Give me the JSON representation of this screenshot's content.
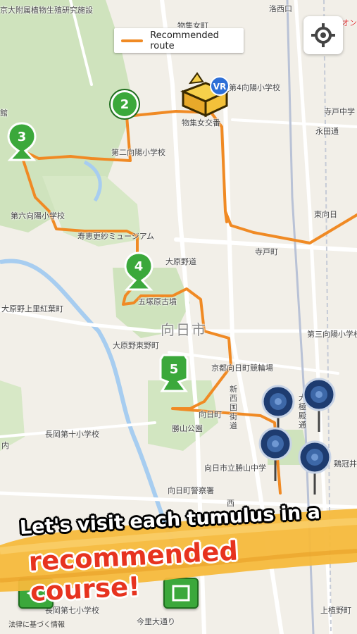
{
  "legend": {
    "label": "Recommended route"
  },
  "locate_button": {
    "icon": "crosshair-icon"
  },
  "map": {
    "labels": [
      {
        "id": "l1",
        "text": "京大附属植物生殖研究施設"
      },
      {
        "id": "l2",
        "text": "物集女町"
      },
      {
        "id": "l3",
        "text": "洛西口"
      },
      {
        "id": "l4",
        "text": "イオンモ"
      },
      {
        "id": "l5",
        "text": "第4向陽小学校"
      },
      {
        "id": "l6",
        "text": "寺戸中学"
      },
      {
        "id": "l7",
        "text": "永田通"
      },
      {
        "id": "l8",
        "text": "物集女交番"
      },
      {
        "id": "l9",
        "text": "第二向陽小学校"
      },
      {
        "id": "l10",
        "text": "東向日"
      },
      {
        "id": "l11",
        "text": "第六向陽小学校"
      },
      {
        "id": "l12",
        "text": "寿恵更紗ミュージアム"
      },
      {
        "id": "l13",
        "text": "寺戸町"
      },
      {
        "id": "l14",
        "text": "大原野道"
      },
      {
        "id": "l15",
        "text": "五塚原古墳"
      },
      {
        "id": "l16",
        "text": "大原野上里紅葉町"
      },
      {
        "id": "l17",
        "text": "向日市"
      },
      {
        "id": "l18",
        "text": "第三向陽小学校"
      },
      {
        "id": "l19",
        "text": "大原野東野町"
      },
      {
        "id": "l20",
        "text": "京都向日町競輪場"
      },
      {
        "id": "l21",
        "text": "新西国街道"
      },
      {
        "id": "l22",
        "text": "大極殿通"
      },
      {
        "id": "l23",
        "text": "向日町"
      },
      {
        "id": "l24",
        "text": "勝山公園"
      },
      {
        "id": "l25",
        "text": "長岡第十小学校"
      },
      {
        "id": "l26",
        "text": "内"
      },
      {
        "id": "l27",
        "text": "鶏冠井"
      },
      {
        "id": "l28",
        "text": "向日市立勝山中学"
      },
      {
        "id": "l29",
        "text": "向日町警察署"
      },
      {
        "id": "l30",
        "text": "西"
      },
      {
        "id": "l31",
        "text": "長岡第七小学校"
      },
      {
        "id": "l32",
        "text": "上植野町"
      },
      {
        "id": "l33",
        "text": "今里大通り"
      },
      {
        "id": "l34",
        "text": "館"
      }
    ],
    "markers": [
      {
        "id": "m2",
        "number": "2"
      },
      {
        "id": "m3",
        "number": "3"
      },
      {
        "id": "m4",
        "number": "4"
      },
      {
        "id": "m5",
        "number": "5"
      }
    ],
    "vr_badge": "VR",
    "tumulus_pins": 4
  },
  "banner": {
    "line1": "Let's visit each tumulus in a",
    "line2": "recommended course!"
  },
  "footer": {
    "text": "法律に基づく情報"
  },
  "colors": {
    "route": "#f08a24",
    "marker_green": "#3ba83b",
    "pin_blue": "#2d4f8a",
    "banner_red": "#e7331f"
  }
}
